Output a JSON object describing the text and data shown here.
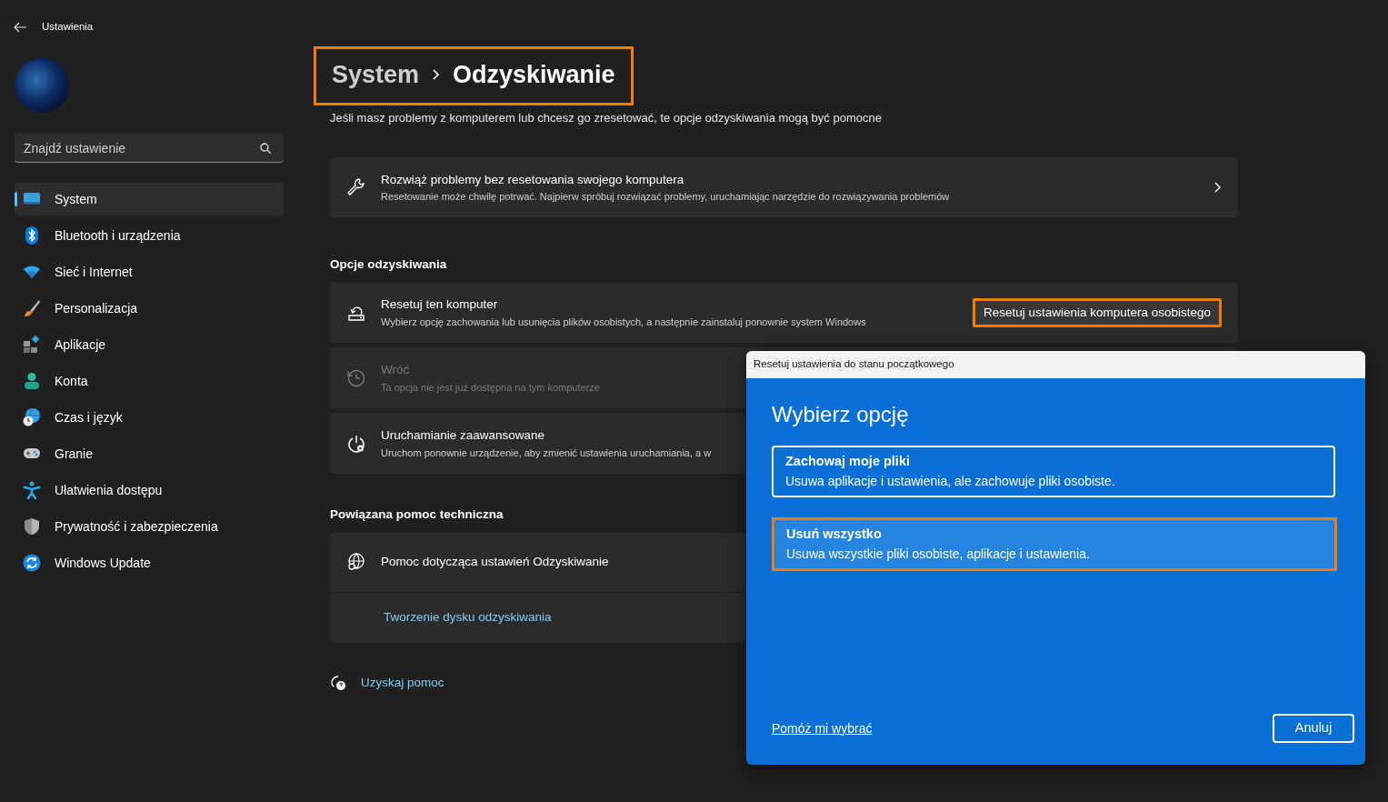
{
  "window": {
    "title": "Ustawienia"
  },
  "search": {
    "placeholder": "Znajdź ustawienie"
  },
  "nav": [
    {
      "label": "System",
      "kind": "system",
      "selected": true
    },
    {
      "label": "Bluetooth i urządzenia",
      "kind": "bluetooth",
      "selected": false
    },
    {
      "label": "Sieć i Internet",
      "kind": "wifi",
      "selected": false
    },
    {
      "label": "Personalizacja",
      "kind": "brush",
      "selected": false
    },
    {
      "label": "Aplikacje",
      "kind": "apps",
      "selected": false
    },
    {
      "label": "Konta",
      "kind": "person",
      "selected": false
    },
    {
      "label": "Czas i język",
      "kind": "clock",
      "selected": false
    },
    {
      "label": "Granie",
      "kind": "gamepad",
      "selected": false
    },
    {
      "label": "Ułatwienia dostępu",
      "kind": "accessibility",
      "selected": false
    },
    {
      "label": "Prywatność i zabezpieczenia",
      "kind": "shield",
      "selected": false
    },
    {
      "label": "Windows Update",
      "kind": "update",
      "selected": false
    }
  ],
  "page": {
    "breadcrumb_parent": "System",
    "breadcrumb_current": "Odzyskiwanie",
    "highlighted": true,
    "description": "Jeśli masz problemy z komputerem lub chcesz go zresetować, te opcje odzyskiwania mogą być pomocne"
  },
  "troubleshoot_card": {
    "title": "Rozwiąż problemy bez resetowania swojego komputera",
    "subtitle": "Resetowanie może chwilę potrwać. Najpierw spróbuj rozwiązać problemy, uruchamiając narzędzie do rozwiązywania problemów"
  },
  "recovery": {
    "heading": "Opcje odzyskiwania",
    "items": [
      {
        "kind": "reset",
        "title": "Resetuj ten komputer",
        "subtitle": "Wybierz opcję zachowania lub usunięcia plików osobistych, a następnie zainstaluj ponownie system Windows",
        "disabled": false,
        "button": {
          "label": "Resetuj ustawienia komputera osobistego",
          "highlighted": true
        }
      },
      {
        "kind": "history",
        "title": "Wróć",
        "subtitle": "Ta opcja nie jest już dostępna na tym komputerze",
        "disabled": true
      },
      {
        "kind": "power",
        "title": "Uruchamianie zaawansowane",
        "subtitle": "Uruchom ponownie urządzenie, aby zmienić ustawienia uruchamiania, a w",
        "disabled": false
      }
    ]
  },
  "related": {
    "heading": "Powiązana pomoc techniczna",
    "title": "Pomoc dotycząca ustawień Odzyskiwanie",
    "links": [
      "Tworzenie dysku odzyskiwania"
    ]
  },
  "get_help": {
    "label": "Uzyskaj pomoc"
  },
  "dialog": {
    "title": "Resetuj ustawienia do stanu początkowego",
    "heading": "Wybierz opcję",
    "options": [
      {
        "title": "Zachowaj moje pliki",
        "description": "Usuwa aplikacje i ustawienia, ale zachowuje pliki osobiste.",
        "selected": false,
        "highlighted": false
      },
      {
        "title": "Usuń wszystko",
        "description": "Usuwa wszystkie pliki osobiste, aplikacje i ustawienia.",
        "selected": true,
        "highlighted": true
      }
    ],
    "help_link": "Pomóż mi wybrać",
    "cancel": "Anuluj"
  }
}
